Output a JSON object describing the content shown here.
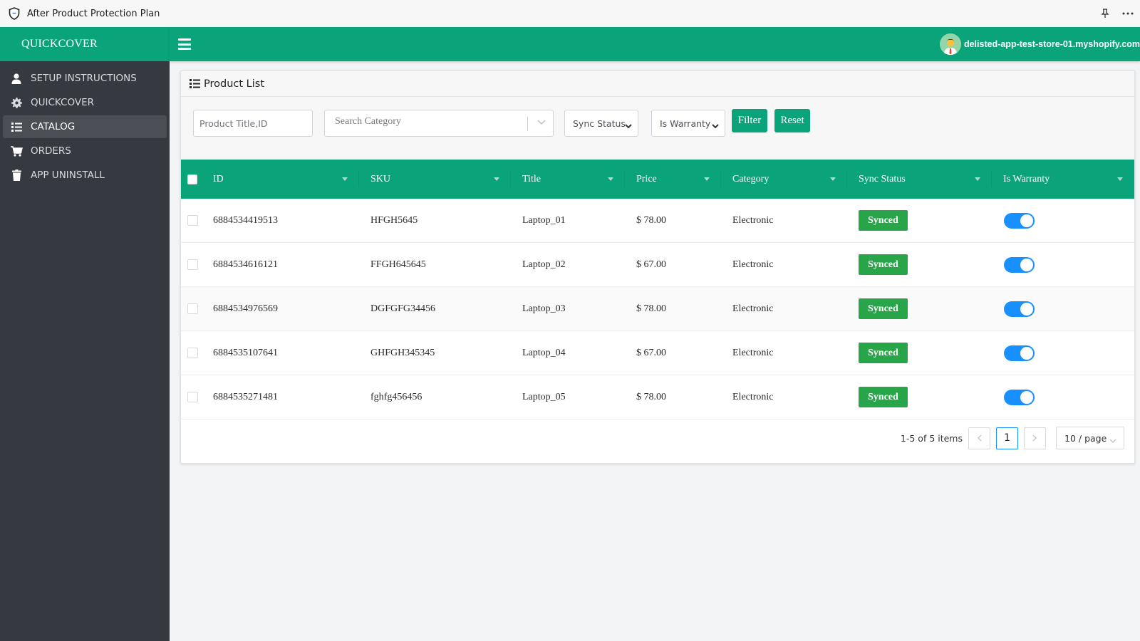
{
  "window": {
    "title": "After Product Protection Plan",
    "icons": {
      "app": "shield-icon",
      "pin": "pin-icon",
      "more": "more-icon"
    }
  },
  "sidebar": {
    "brand": "QUICKCOVER",
    "items": [
      {
        "label": "SETUP INSTRUCTIONS",
        "icon": "user-icon",
        "active": false
      },
      {
        "label": "QUICKCOVER",
        "icon": "gear-icon",
        "active": false
      },
      {
        "label": "CATALOG",
        "icon": "list-icon",
        "active": true
      },
      {
        "label": "ORDERS",
        "icon": "cart-icon",
        "active": false
      },
      {
        "label": "APP UNINSTALL",
        "icon": "trash-icon",
        "active": false
      }
    ]
  },
  "header": {
    "menu_icon": "hamburger-icon",
    "store": "delisted-app-test-store-01.myshopify.com"
  },
  "card": {
    "title": "Product List"
  },
  "filters": {
    "title_placeholder": "Product Title,ID",
    "category_placeholder": "Search Category",
    "sync_status": "Sync Status",
    "is_warranty": "Is Warranty",
    "filter_label": "Filter",
    "reset_label": "Reset"
  },
  "table": {
    "columns": [
      "ID",
      "SKU",
      "Title",
      "Price",
      "Category",
      "Sync Status",
      "Is Warranty"
    ],
    "rows": [
      {
        "id": "6884534419513",
        "sku": "HFGH5645",
        "title": "Laptop_01",
        "price": "$ 78.00",
        "category": "Electronic",
        "sync": "Synced",
        "warranty": true
      },
      {
        "id": "6884534616121",
        "sku": "FFGH645645",
        "title": "Laptop_02",
        "price": "$ 67.00",
        "category": "Electronic",
        "sync": "Synced",
        "warranty": true
      },
      {
        "id": "6884534976569",
        "sku": "DGFGFG34456",
        "title": "Laptop_03",
        "price": "$ 78.00",
        "category": "Electronic",
        "sync": "Synced",
        "warranty": true
      },
      {
        "id": "6884535107641",
        "sku": "GHFGH345345",
        "title": "Laptop_04",
        "price": "$ 67.00",
        "category": "Electronic",
        "sync": "Synced",
        "warranty": true
      },
      {
        "id": "6884535271481",
        "sku": "fghfg456456",
        "title": "Laptop_05",
        "price": "$ 78.00",
        "category": "Electronic",
        "sync": "Synced",
        "warranty": true
      }
    ]
  },
  "pagination": {
    "total_text": "1-5 of 5 items",
    "prev": "<",
    "current": "1",
    "next": ">",
    "page_size": "10 / page"
  },
  "colors": {
    "brand": "#0aa37a",
    "sidebar": "#343a40",
    "synced": "#27a548",
    "toggle_on": "#1890ff"
  }
}
